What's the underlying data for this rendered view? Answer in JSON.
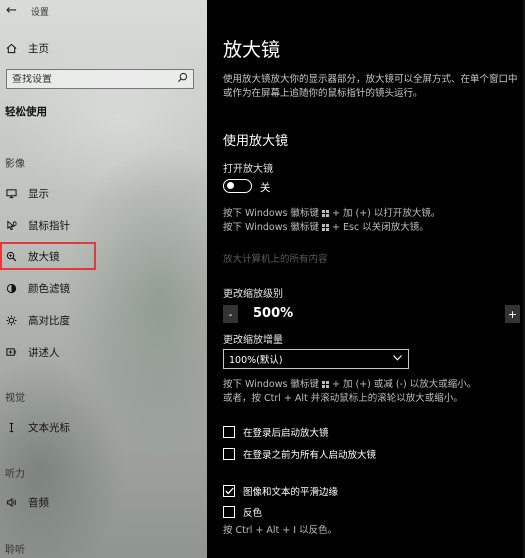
{
  "window": {
    "title": "设置"
  },
  "sidebar": {
    "home_label": "主页",
    "search_placeholder": "查找设置",
    "category_title": "轻松使用",
    "sections": [
      {
        "label": "影像",
        "items": [
          {
            "label": "显示",
            "icon": "monitor-icon"
          },
          {
            "label": "鼠标指针",
            "icon": "pointer-icon"
          },
          {
            "label": "放大镜",
            "icon": "magnifier-icon",
            "selected": true
          },
          {
            "label": "颜色滤镜",
            "icon": "color-filter-icon"
          },
          {
            "label": "高对比度",
            "icon": "contrast-icon"
          },
          {
            "label": "讲述人",
            "icon": "narrator-icon"
          }
        ]
      },
      {
        "label": "视觉",
        "items": [
          {
            "label": "文本光标",
            "icon": "text-cursor-icon"
          }
        ]
      },
      {
        "label": "听力",
        "items": [
          {
            "label": "音频",
            "icon": "speaker-icon"
          }
        ]
      },
      {
        "label": "聆听",
        "items": []
      }
    ]
  },
  "main": {
    "title": "放大镜",
    "description": "使用放大镜放大你的显示器部分，放大镜可以全屏方式、在单个窗口中或作为在屏幕上追随你的鼠标指针的镜头运行。",
    "section_title": "使用放大镜",
    "toggle": {
      "label": "打开放大镜",
      "state_text": "关",
      "on": false
    },
    "hint_on": [
      "按下 Windows 徽标键",
      "+ 加 (+) 以打开放大镜。"
    ],
    "hint_off": [
      "按下 Windows 徽标键",
      "+ Esc 以关闭放大镜。"
    ],
    "disabled_text": "放大计算机上的所有内容",
    "zoom": {
      "label": "更改缩放级别",
      "minus": "-",
      "value": "500%",
      "plus": "+"
    },
    "increment": {
      "label": "更改缩放增量",
      "selected": "100%(默认)"
    },
    "zoom_hint": [
      "按下 Windows 徽标键",
      "+ 加 (+) 或减 (-) 以放大或缩小。",
      "或者，按 Ctrl + Alt 并滚动鼠标上的滚轮以放大或缩小。"
    ],
    "checkboxes": [
      {
        "label": "在登录后启动放大镜",
        "checked": false
      },
      {
        "label": "在登录之前为所有人启动放大镜",
        "checked": false
      },
      {
        "label": "图像和文本的平滑边缘",
        "checked": true
      },
      {
        "label": "反色",
        "checked": false
      }
    ],
    "invert_hint": "按 Ctrl + Alt + I 以反色。"
  }
}
